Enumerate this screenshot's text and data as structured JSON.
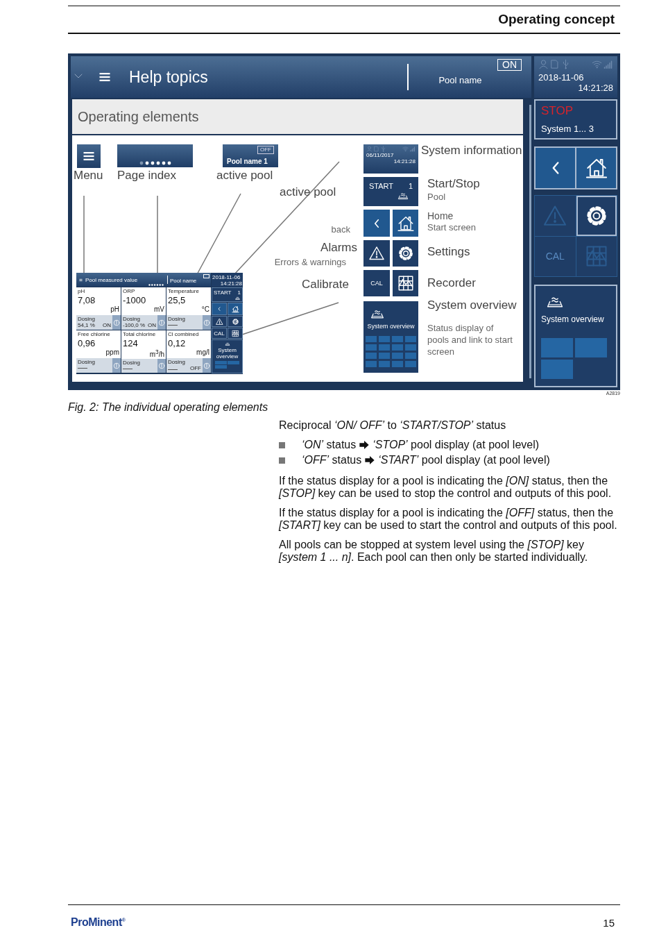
{
  "page_header": {
    "title": "Operating concept"
  },
  "figure": {
    "top_bar": {
      "title": "Help topics",
      "pool_status": "ON",
      "pool_name": "Pool name"
    },
    "status_panel": {
      "date": "2018-11-06",
      "time": "14:21:28"
    },
    "section_title": "Operating elements",
    "canvas": {
      "menu_label": "Menu",
      "page_index_label": "Page index",
      "pool_tile": {
        "status": "OFF",
        "name": "Pool name 1"
      },
      "pool_tile_label": "active pool",
      "callouts": [
        {
          "kind": "big",
          "text": "active pool"
        },
        {
          "kind": "small",
          "text": "back"
        },
        {
          "kind": "big",
          "text": "Alarms"
        },
        {
          "kind": "small",
          "text": "Errors & warnings"
        },
        {
          "kind": "big",
          "text": "Calibrate"
        }
      ],
      "info_tile": {
        "date": "06/11/2017",
        "time": "14:21:28"
      },
      "start_tile": {
        "label": "START",
        "number": "1"
      },
      "cal_label": "CAL",
      "overview_tile": {
        "label": "System overview"
      },
      "descriptions": [
        {
          "title": "System information"
        },
        {
          "title": "Start/Stop",
          "subtitle": "Pool"
        },
        {
          "title": "Home",
          "subtitle": "Start screen"
        },
        {
          "title": "Settings"
        },
        {
          "title": "Recorder"
        },
        {
          "title": "System overview",
          "subtitle": "Status display of pools and link to start screen"
        }
      ]
    },
    "mini_screen": {
      "title": "Pool measured value",
      "pool_name": "Pool name",
      "date": "2018-11-06",
      "time": "14:21:28",
      "start": "START",
      "start_number": "1",
      "cal": "CAL",
      "overview": "System overview",
      "tiles": [
        {
          "label": "pH",
          "value": "7,08",
          "unit": "pH",
          "dosing_label": "Dosing",
          "dosing_value": "54,1 %",
          "state": "ON"
        },
        {
          "label": "ORP",
          "value": "-1000",
          "unit": "mV",
          "dosing_label": "Dosing",
          "dosing_value": "-100,0 %",
          "state": "ON"
        },
        {
          "label": "Temperature",
          "value": "25,5",
          "unit": "°C",
          "dosing_label": "Dosing"
        },
        {
          "label": "Free chlorine",
          "value": "0,96",
          "unit": "ppm",
          "dosing_label": "Dosing"
        },
        {
          "label": "Total chlorine",
          "value": "124",
          "unit": "m$^{3}$/h",
          "dosing_label": "Dosing"
        },
        {
          "label": "Cl combined",
          "value": "0,12",
          "unit": "mg/l",
          "dosing_label": "Dosing",
          "state": "OFF"
        }
      ]
    },
    "side_panel": {
      "stop": "STOP",
      "system": "System 1... 3",
      "tools": [
        {
          "kind": "alarm",
          "selected": false
        },
        {
          "kind": "settings",
          "selected": true
        },
        {
          "kind": "cal",
          "label": "CAL",
          "selected": false
        },
        {
          "kind": "recorder",
          "selected": false
        }
      ],
      "overview": "System overview"
    },
    "figure_id": "A2819"
  },
  "caption": "Fig. 2: The individual operating elements",
  "body": {
    "intro": "Reciprocal *‘ON/ OFF’* to *‘START/STOP’* status",
    "bullets": [
      {
        "before": "*‘ON’* status",
        "after": "*‘STOP’* pool display (at pool level)"
      },
      {
        "before": "*‘OFF’* status",
        "after": "*‘START’* pool display (at pool level)"
      }
    ],
    "paragraphs": [
      "If the status display for a pool is indicating the *[ON]* status, then the *[STOP]* key can be used to stop the control and outputs of this pool.",
      "If the status display for a pool is indicating the *[OFF]* status, then the *[START]* key can be used to start the control and outputs of this pool.",
      "All pools can be stopped at system level using the *[STOP]* key *[system 1 ... n]*. Each pool can then only be started individually."
    ]
  },
  "footer": {
    "logo": "ProMinent$^{®}$",
    "page": "15"
  }
}
